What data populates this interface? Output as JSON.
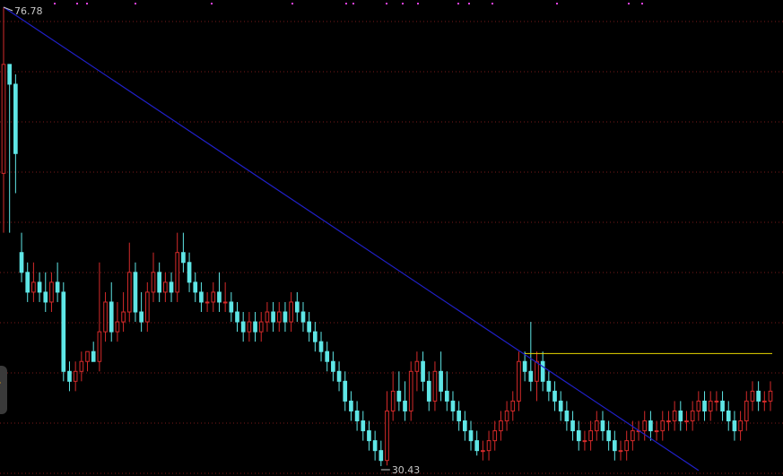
{
  "chart_data": {
    "type": "candlestick",
    "price_axis": {
      "min": 30.43,
      "max": 76.78
    },
    "annotations": {
      "high_label": "76.78",
      "low_label": "30.43"
    },
    "markers": {
      "trend_line": {
        "from": {
          "index": 0,
          "price": 76.78
        },
        "to": {
          "index": 116,
          "price": 30.0
        }
      },
      "resistance": {
        "price": 41.8,
        "from_index": 87
      }
    },
    "colors": {
      "background": "#000000",
      "up": "#d42a2a",
      "down": "#5fe6e6",
      "trend_line": "#2020c8",
      "resistance_line": "#e8d800",
      "grid": "#7a1a1a",
      "label": "#c8c8c8",
      "top_marker": "#e040e0"
    },
    "candles": [
      [
        60,
        76.78,
        54,
        71
      ],
      [
        71,
        71,
        54,
        69
      ],
      [
        69,
        70,
        58,
        62
      ],
      [
        52,
        54,
        49,
        50
      ],
      [
        50,
        51,
        47,
        48
      ],
      [
        48,
        51,
        47,
        49
      ],
      [
        49,
        50,
        47,
        48
      ],
      [
        48,
        50,
        46,
        47
      ],
      [
        47,
        50,
        46,
        49
      ],
      [
        49,
        51,
        47,
        48
      ],
      [
        48,
        49,
        39,
        40
      ],
      [
        40,
        41,
        38,
        39
      ],
      [
        39,
        41,
        38,
        40
      ],
      [
        40,
        42,
        39,
        41
      ],
      [
        41,
        42,
        40,
        42
      ],
      [
        42,
        43,
        41,
        41
      ],
      [
        41,
        51,
        40,
        44
      ],
      [
        44,
        48,
        43,
        47
      ],
      [
        47,
        49,
        43,
        44
      ],
      [
        44,
        47,
        43,
        45
      ],
      [
        45,
        48,
        44,
        46
      ],
      [
        46,
        53,
        45,
        50
      ],
      [
        50,
        51,
        45,
        46
      ],
      [
        46,
        48,
        44,
        45
      ],
      [
        45,
        49,
        44,
        48
      ],
      [
        48,
        52,
        47,
        50
      ],
      [
        50,
        51,
        47,
        48
      ],
      [
        48,
        50,
        47,
        49
      ],
      [
        49,
        50,
        47,
        48
      ],
      [
        48,
        54,
        47,
        52
      ],
      [
        52,
        54,
        50,
        51
      ],
      [
        51,
        52,
        48,
        49
      ],
      [
        49,
        50,
        47,
        48
      ],
      [
        48,
        49,
        46,
        47
      ],
      [
        47,
        48,
        46,
        47
      ],
      [
        47,
        49,
        46,
        48
      ],
      [
        48,
        50,
        46,
        47
      ],
      [
        47,
        49,
        46,
        47
      ],
      [
        47,
        48,
        45,
        46
      ],
      [
        46,
        47,
        44,
        45
      ],
      [
        45,
        46,
        43,
        44
      ],
      [
        44,
        46,
        43,
        45
      ],
      [
        45,
        46,
        43,
        44
      ],
      [
        44,
        46,
        43,
        45
      ],
      [
        45,
        47,
        44,
        46
      ],
      [
        46,
        47,
        44,
        45
      ],
      [
        45,
        47,
        44,
        46
      ],
      [
        46,
        47,
        44,
        45
      ],
      [
        45,
        48,
        44,
        47
      ],
      [
        47,
        48,
        45,
        46
      ],
      [
        46,
        47,
        44,
        45
      ],
      [
        45,
        46,
        43,
        44
      ],
      [
        44,
        45,
        42,
        43
      ],
      [
        43,
        44,
        41,
        42
      ],
      [
        42,
        43,
        40,
        41
      ],
      [
        41,
        42,
        39,
        40
      ],
      [
        40,
        41,
        38,
        39
      ],
      [
        39,
        40,
        36,
        37
      ],
      [
        37,
        38,
        35,
        36
      ],
      [
        36,
        37,
        34,
        35
      ],
      [
        35,
        36,
        33,
        34
      ],
      [
        34,
        35,
        32,
        33
      ],
      [
        33,
        34,
        31,
        32
      ],
      [
        32,
        33,
        30.43,
        31
      ],
      [
        31,
        38,
        30.5,
        36
      ],
      [
        36,
        40,
        35,
        38
      ],
      [
        38,
        40,
        36,
        37
      ],
      [
        37,
        39,
        35,
        36
      ],
      [
        36,
        41,
        35,
        40
      ],
      [
        40,
        42,
        38,
        41
      ],
      [
        41,
        42,
        38,
        39
      ],
      [
        39,
        40,
        36,
        37
      ],
      [
        37,
        41,
        36,
        40
      ],
      [
        40,
        42,
        37,
        38
      ],
      [
        38,
        40,
        36,
        37
      ],
      [
        37,
        38,
        35,
        36
      ],
      [
        36,
        37,
        34,
        35
      ],
      [
        35,
        36,
        33,
        34
      ],
      [
        34,
        35,
        32,
        33
      ],
      [
        33,
        34,
        31.5,
        32
      ],
      [
        32,
        33,
        31,
        32
      ],
      [
        32,
        34,
        31,
        33
      ],
      [
        33,
        35,
        32,
        34
      ],
      [
        34,
        36,
        33,
        35
      ],
      [
        35,
        37,
        34,
        36
      ],
      [
        36,
        38,
        35,
        37
      ],
      [
        37,
        42,
        36,
        41
      ],
      [
        41,
        42,
        39,
        40
      ],
      [
        40,
        45,
        38,
        39
      ],
      [
        39,
        42,
        37,
        41
      ],
      [
        41,
        42,
        38,
        39
      ],
      [
        39,
        40,
        37,
        38
      ],
      [
        38,
        39,
        36,
        37
      ],
      [
        37,
        38,
        35,
        36
      ],
      [
        36,
        37,
        34,
        35
      ],
      [
        35,
        36,
        33,
        34
      ],
      [
        34,
        35,
        32,
        33
      ],
      [
        33,
        34,
        32,
        33
      ],
      [
        33,
        35,
        32,
        34
      ],
      [
        34,
        36,
        33,
        35
      ],
      [
        35,
        36,
        33,
        34
      ],
      [
        34,
        35,
        32,
        33
      ],
      [
        33,
        34,
        31,
        32
      ],
      [
        32,
        33,
        31,
        32
      ],
      [
        32,
        34,
        31,
        33
      ],
      [
        33,
        35,
        32,
        34
      ],
      [
        34,
        35,
        33,
        34
      ],
      [
        34,
        36,
        33,
        35
      ],
      [
        35,
        36,
        33,
        34
      ],
      [
        34,
        35,
        33,
        34
      ],
      [
        34,
        36,
        33,
        35
      ],
      [
        35,
        36,
        34,
        35
      ],
      [
        35,
        37,
        34,
        36
      ],
      [
        36,
        37,
        34,
        35
      ],
      [
        35,
        36,
        34,
        35
      ],
      [
        35,
        37,
        34,
        36
      ],
      [
        36,
        38,
        35,
        37
      ],
      [
        37,
        38,
        35,
        36
      ],
      [
        36,
        38,
        35,
        37
      ],
      [
        37,
        38,
        36,
        37
      ],
      [
        37,
        38,
        35,
        36
      ],
      [
        36,
        37,
        34,
        35
      ],
      [
        35,
        36,
        33,
        34
      ],
      [
        34,
        36,
        33,
        35
      ],
      [
        35,
        38,
        34,
        37
      ],
      [
        37,
        39,
        36,
        38
      ],
      [
        38,
        39,
        36,
        37
      ],
      [
        37,
        38,
        36,
        37
      ],
      [
        37,
        39,
        36,
        38
      ]
    ]
  }
}
